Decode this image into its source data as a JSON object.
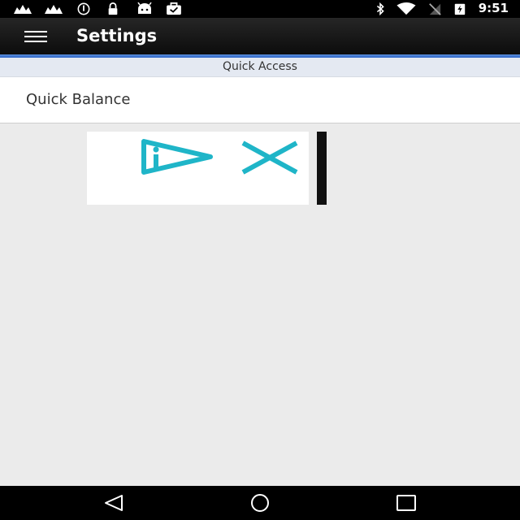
{
  "status_bar": {
    "time": "9:51",
    "left_icons": [
      "signal-icon",
      "signal-icon",
      "info-icon",
      "lock-icon",
      "android-icon",
      "briefcase-icon"
    ],
    "right_icons": [
      "bluetooth-icon",
      "wifi-icon",
      "no-sim-icon",
      "battery-charging-icon"
    ]
  },
  "app_bar": {
    "title": "Settings",
    "menu_icon": "hamburger-menu-icon"
  },
  "section": {
    "header": "Quick Access",
    "items": [
      {
        "label": "Quick Balance"
      }
    ]
  },
  "ad": {
    "icons": [
      "adchoices-icon",
      "close-icon"
    ],
    "accent_color": "#1fb5c8"
  },
  "nav_bar": {
    "buttons": [
      "back-icon",
      "home-icon",
      "recents-icon"
    ]
  },
  "colors": {
    "app_bar": "#1a1a1a",
    "accent_line": "#3a6fd0",
    "background": "#ebebeb"
  }
}
